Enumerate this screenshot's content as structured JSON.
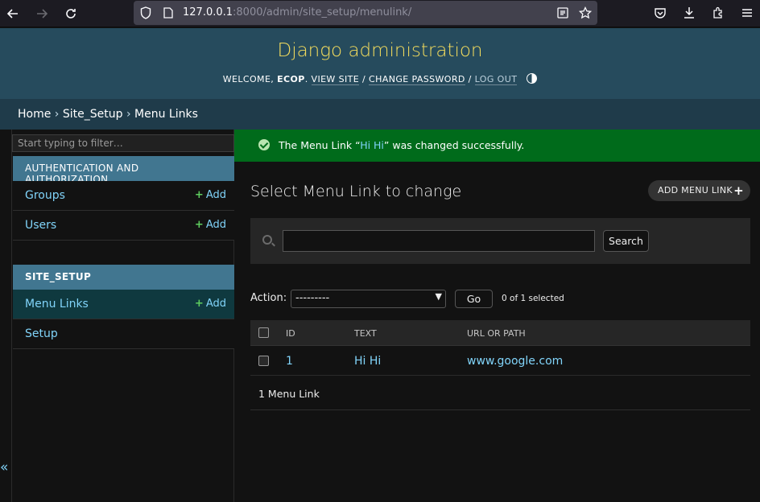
{
  "browser": {
    "url_prefix": "127.0.0.1",
    "url_rest": ":8000/admin/site_setup/menulink/"
  },
  "header": {
    "branding": "Django administration",
    "welcome": "Welcome,",
    "username": "ecop",
    "view_site": "View site",
    "change_password": "Change password",
    "log_out": "Log out"
  },
  "breadcrumbs": {
    "home": "Home",
    "app": "Site_Setup",
    "current": "Menu Links",
    "sep": "›"
  },
  "sidebar": {
    "toggle": "«",
    "filter_placeholder": "Start typing to filter…",
    "modules": [
      {
        "caption": "Authentication and Authorization",
        "models": [
          {
            "name": "Groups",
            "add": "Add"
          },
          {
            "name": "Users",
            "add": "Add"
          }
        ]
      },
      {
        "caption": "Site_Setup",
        "models": [
          {
            "name": "Menu Links",
            "add": "Add"
          },
          {
            "name": "Setup"
          }
        ]
      }
    ]
  },
  "message": {
    "prefix": "The Menu Link “",
    "object": "Hi Hi",
    "suffix": "” was changed successfully."
  },
  "content": {
    "title": "Select Menu Link to change",
    "add_button": "Add Menu Link",
    "search_button": "Search",
    "search_value": "",
    "action_label": "Action:",
    "action_selected": "---------",
    "go_button": "Go",
    "selected_count": "0 of 1 selected",
    "columns": [
      "ID",
      "Text",
      "URL or Path"
    ],
    "rows": [
      {
        "id": "1",
        "text": "Hi Hi",
        "url": "www.google.com"
      }
    ],
    "paginator": "1 Menu Link"
  },
  "colors": {
    "header_bg": "#264b5d",
    "branding": "#f5dd5d",
    "module_bg": "#417690",
    "success_bg": "#006b1b",
    "link": "#81d4fa"
  }
}
